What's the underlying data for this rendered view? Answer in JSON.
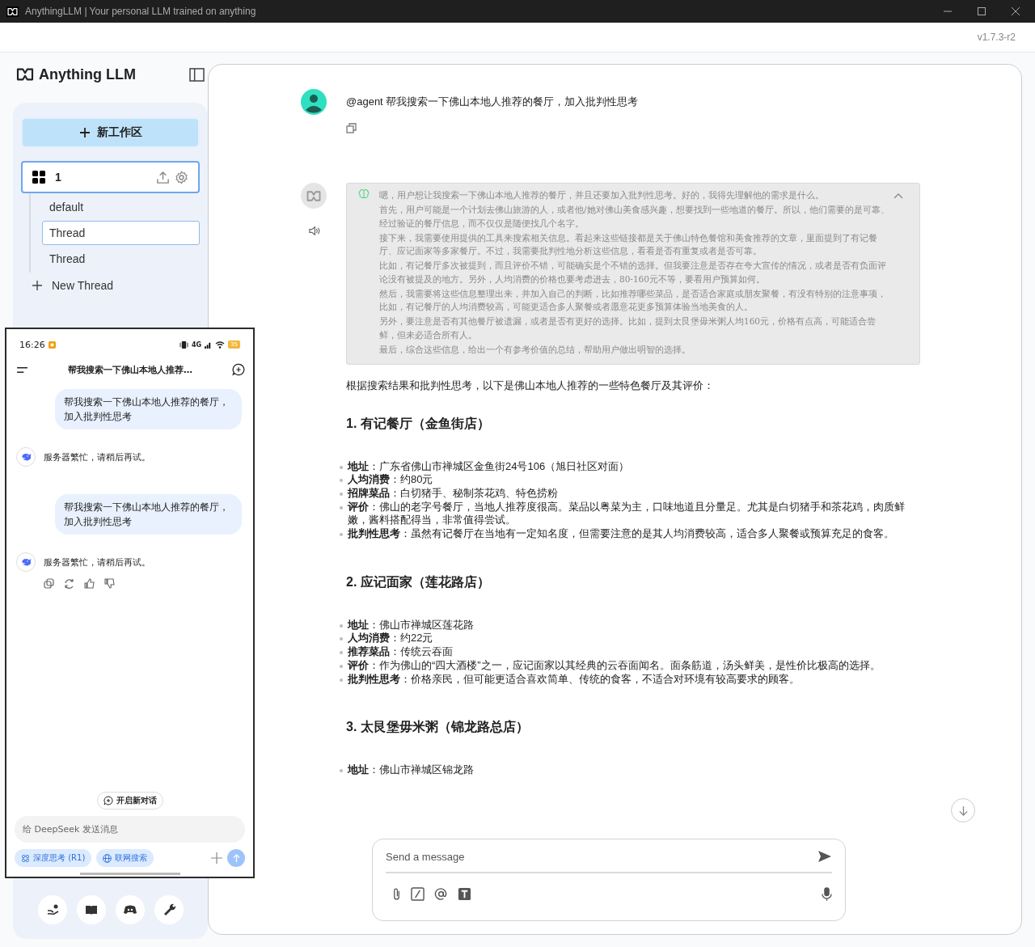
{
  "window": {
    "title": "AnythingLLM | Your personal LLM trained on anything",
    "version": "v1.7.3-r2"
  },
  "sidebar": {
    "logo": "Anything LLM",
    "new_workspace": "新工作区",
    "workspace": {
      "name": "1",
      "selected": true
    },
    "threads": [
      {
        "label": "default",
        "selected": false
      },
      {
        "label": "Thread",
        "selected": true
      },
      {
        "label": "Thread",
        "selected": false
      }
    ],
    "new_thread": "New Thread"
  },
  "chat": {
    "user_message": "@agent 帮我搜索一下佛山本地人推荐的餐厅，加入批判性思考",
    "thinking": {
      "expanded": true,
      "paragraphs": [
        "嗯，用户想让我搜索一下佛山本地人推荐的餐厅，并且还要加入批判性思考。好的，我得先理解他的需求是什么。",
        "首先，用户可能是一个计划去佛山旅游的人，或者他/她对佛山美食感兴趣，想要找到一些地道的餐厅。所以，他们需要的是可靠、经过验证的餐厅信息，而不仅仅是随便找几个名字。",
        "接下来，我需要使用提供的工具来搜索相关信息。看起来这些链接都是关于佛山特色餐馆和美食推荐的文章，里面提到了有记餐厅、应记面家等多家餐厅。不过，我需要批判性地分析这些信息，看看是否有重复或者是否可靠。",
        "比如，有记餐厅多次被提到，而且评价不错，可能确实是个不错的选择。但我要注意是否存在夸大宣传的情况，或者是否有负面评论没有被提及的地方。另外，人均消费的价格也要考虑进去，80-160元不等，要看用户预算如何。",
        "然后，我需要将这些信息整理出来，并加入自己的判断，比如推荐哪些菜品，是否适合家庭或朋友聚餐，有没有特别的注意事项，比如，有记餐厅的人均消费较高，可能更适合多人聚餐或者愿意花更多预算体验当地美食的人。",
        "另外，要注意是否有其他餐厅被遗漏，或者是否有更好的选择。比如，提到太艮堡毋米粥人均160元，价格有点高，可能适合尝鲜，但未必适合所有人。",
        "最后，综合这些信息，给出一个有参考价值的总结，帮助用户做出明智的选择。"
      ]
    },
    "intro": "根据搜索结果和批判性思考，以下是佛山本地人推荐的一些特色餐厅及其评价：",
    "sections": [
      {
        "heading": "1. 有记餐厅（金鱼街店）",
        "items": [
          "**地址**：广东省佛山市禅城区金鱼街24号106（旭日社区对面）",
          "**人均消费**：约80元",
          "**招牌菜品**：白切猪手、秘制茶花鸡、特色捞粉",
          "**评价**：佛山的老字号餐厅，当地人推荐度很高。菜品以粤菜为主，口味地道且分量足。尤其是白切猪手和茶花鸡，肉质鲜嫩，酱料搭配得当，非常值得尝试。",
          "**批判性思考**：虽然有记餐厅在当地有一定知名度，但需要注意的是其人均消费较高，适合多人聚餐或预算充足的食客。"
        ]
      },
      {
        "heading": "2. 应记面家（莲花路店）",
        "items": [
          "**地址**：佛山市禅城区莲花路",
          "**人均消费**：约22元",
          "**推荐菜品**：传统云吞面",
          "**评价**：作为佛山的“四大酒楼”之一，应记面家以其经典的云吞面闻名。面条筋道，汤头鲜美，是性价比极高的选择。",
          "**批判性思考**：价格亲民，但可能更适合喜欢简单、传统的食客，不适合对环境有较高要求的顾客。"
        ]
      },
      {
        "heading": "3. 太艮堡毋米粥（锦龙路总店）",
        "items": [
          "**地址**：佛山市禅城区锦龙路"
        ]
      }
    ]
  },
  "composer": {
    "placeholder": "Send a message"
  },
  "phone": {
    "time": "16:26",
    "network": "4G",
    "battery": "35",
    "title": "帮我搜索一下佛山本地人推荐…",
    "messages": [
      {
        "kind": "user",
        "text": "帮我搜索一下佛山本地人推荐的餐厅，加入批判性思考"
      },
      {
        "kind": "assistant",
        "text": "服务器繁忙，请稍后再试。",
        "actions": false
      },
      {
        "kind": "user",
        "text": "帮我搜索一下佛山本地人推荐的餐厅，加入批判性思考"
      },
      {
        "kind": "assistant",
        "text": "服务器繁忙，请稍后再试。",
        "actions": true
      }
    ],
    "new_chat": "开启新对话",
    "placeholder": "给 DeepSeek 发送消息",
    "chips": [
      {
        "label": "深度思考 (R1)",
        "selected": true
      },
      {
        "label": "联网搜索",
        "selected": true
      }
    ]
  }
}
